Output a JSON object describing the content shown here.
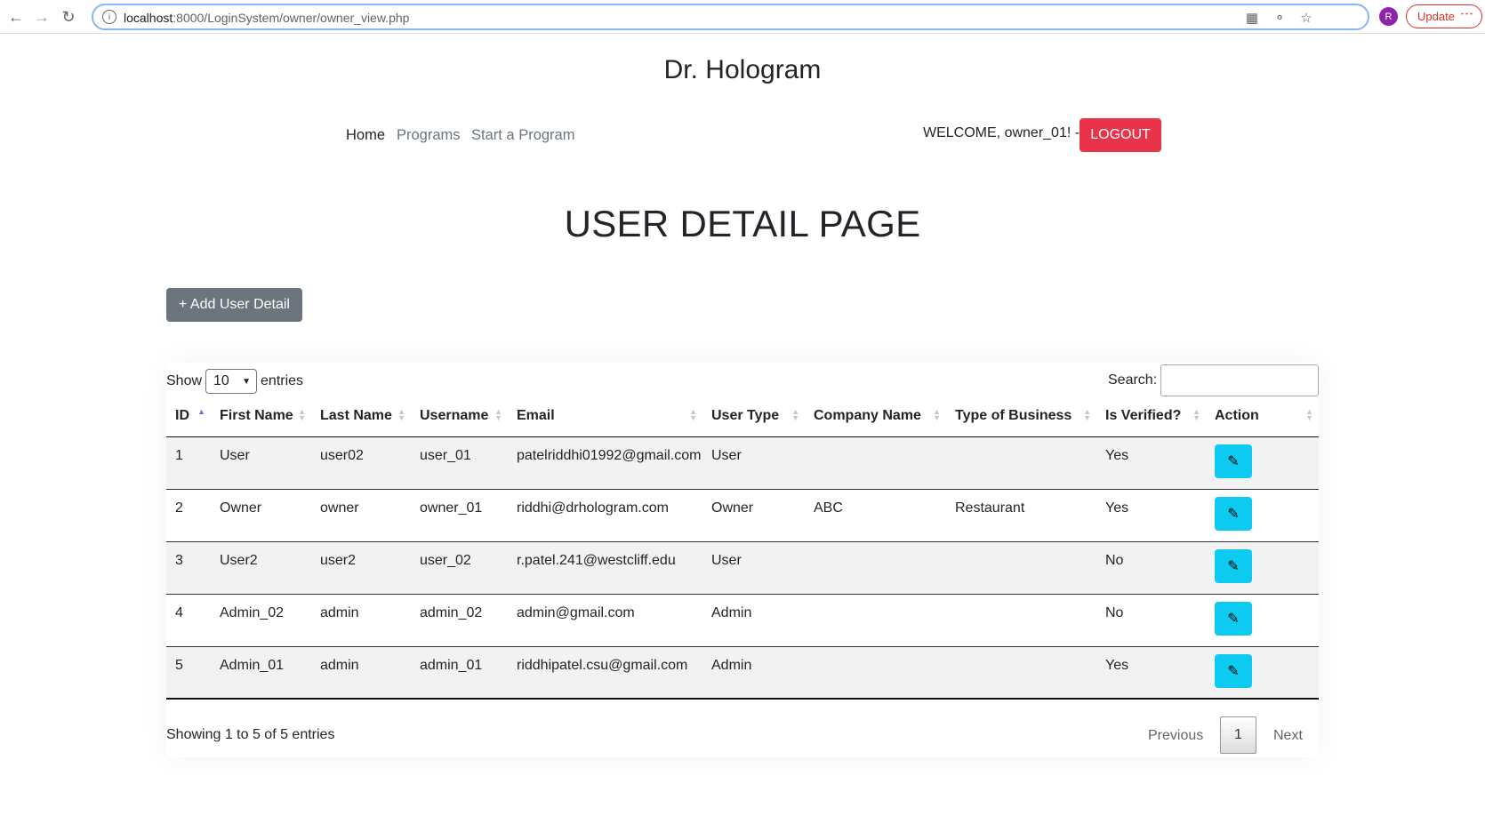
{
  "browser": {
    "url_host": "localhost",
    "url_path": ":8000/LoginSystem/owner/owner_view.php",
    "avatar_letter": "R",
    "update_label": "Update"
  },
  "site": {
    "brand": "Dr. Hologram",
    "nav": [
      "Home",
      "Programs",
      "Start a Program"
    ],
    "welcome": "WELCOME, owner_01! -",
    "logout_label": "LOGOUT",
    "colors": {
      "logout": "#e8334a",
      "add_button": "#6c757d",
      "edit_button": "#0dcaf0"
    }
  },
  "page": {
    "title": "USER DETAIL PAGE",
    "add_label": "+ Add User Detail"
  },
  "table_controls": {
    "show_label": "Show",
    "length_value": "10",
    "entries_label": "entries",
    "search_label": "Search:",
    "search_value": ""
  },
  "table": {
    "columns": [
      "ID",
      "First Name",
      "Last Name",
      "Username",
      "Email",
      "User Type",
      "Company Name",
      "Type of Business",
      "Is Verified?",
      "Action"
    ],
    "sorted_column": "ID",
    "sort_direction": "ascending",
    "rows": [
      [
        "1",
        "User",
        "user02",
        "user_01",
        "patelriddhi01992@gmail.com",
        "User",
        "",
        "",
        "Yes"
      ],
      [
        "2",
        "Owner",
        "owner",
        "owner_01",
        "riddhi@drhologram.com",
        "Owner",
        "ABC",
        "Restaurant",
        "Yes"
      ],
      [
        "3",
        "User2",
        "user2",
        "user_02",
        "r.patel.241@westcliff.edu",
        "User",
        "",
        "",
        "No"
      ],
      [
        "4",
        "Admin_02",
        "admin",
        "admin_02",
        "admin@gmail.com",
        "Admin",
        "",
        "",
        "No"
      ],
      [
        "5",
        "Admin_01",
        "admin",
        "admin_01",
        "riddhipatel.csu@gmail.com",
        "Admin",
        "",
        "",
        "Yes"
      ]
    ],
    "action_icon": "pencil-icon"
  },
  "footer": {
    "info": "Showing 1 to 5 of 5 entries",
    "previous": "Previous",
    "current_page": "1",
    "next": "Next"
  }
}
